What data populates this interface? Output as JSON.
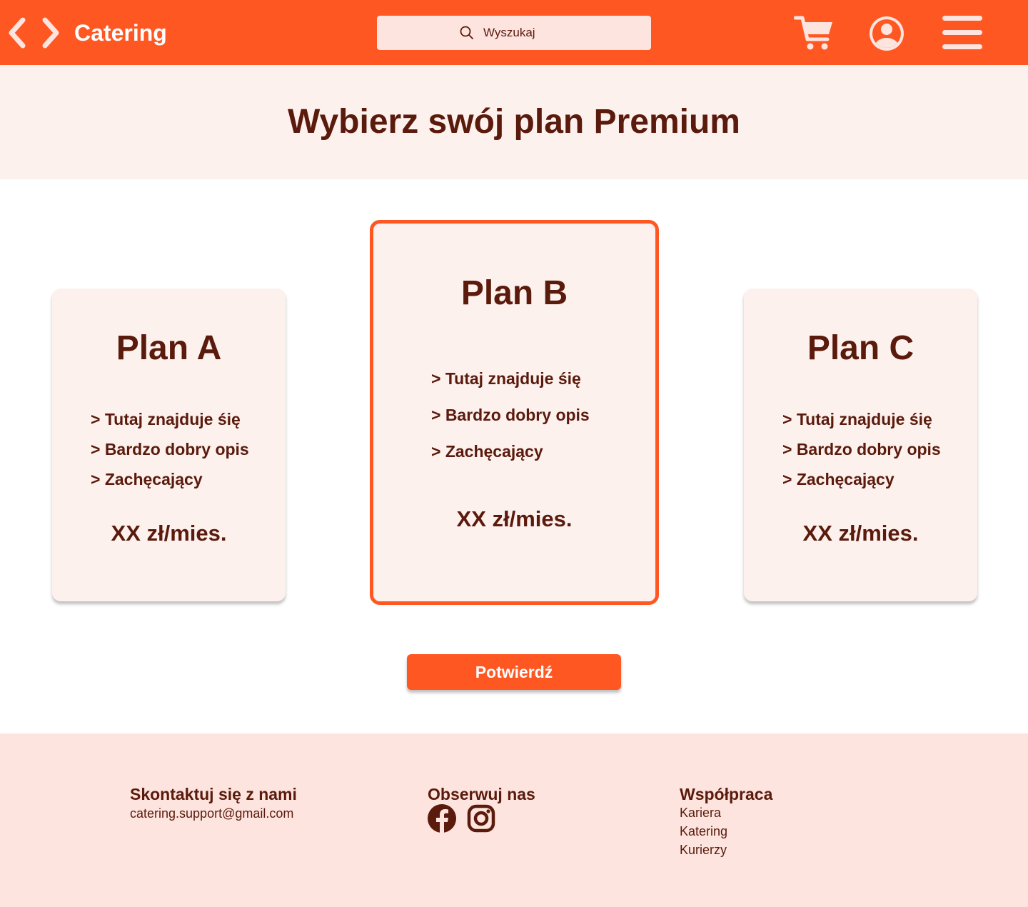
{
  "header": {
    "brand": "Catering",
    "search_placeholder": "Wyszukaj",
    "icons": [
      "back-arrow-icon",
      "forward-arrow-icon",
      "search-icon",
      "cart-icon",
      "user-icon",
      "menu-icon"
    ]
  },
  "hero": {
    "title": "Wybierz swój plan Premium"
  },
  "plans": [
    {
      "name": "Plan A",
      "features": [
        "> Tutaj znajduje śię",
        "> Bardzo dobry opis",
        "> Zachęcający"
      ],
      "price": "XX zł/mies.",
      "selected": false
    },
    {
      "name": "Plan B",
      "features": [
        "> Tutaj znajduje śię",
        "> Bardzo dobry opis",
        "> Zachęcający"
      ],
      "price": "XX zł/mies.",
      "selected": true
    },
    {
      "name": "Plan C",
      "features": [
        "> Tutaj znajduje śię",
        "> Bardzo dobry opis",
        "> Zachęcający"
      ],
      "price": "XX zł/mies.",
      "selected": false
    }
  ],
  "confirm_label": "Potwierdź",
  "footer": {
    "contact_heading": "Skontaktuj się z nami",
    "contact_email": "catering.support@gmail.com",
    "follow_heading": "Obserwuj nas",
    "social_icons": [
      "facebook-icon",
      "instagram-icon"
    ],
    "cooperation_heading": "Współpraca",
    "cooperation_links": [
      "Kariera",
      "Katering",
      "Kurierzy"
    ]
  },
  "colors": {
    "primary": "#ff5722",
    "text": "#5a1a0c",
    "card_bg": "#fdf1ee",
    "footer_bg": "#fde4de",
    "search_bg": "#fde4de"
  }
}
